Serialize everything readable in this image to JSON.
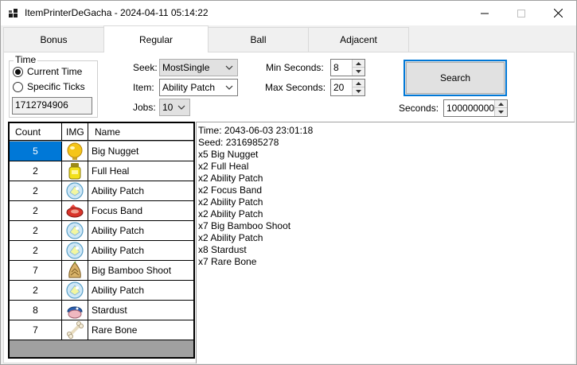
{
  "window": {
    "title": "ItemPrinterDeGacha - 2024-04-11 05:14:22",
    "icon": "app-grid-icon",
    "controls": [
      "minimize-icon",
      "maximize-icon",
      "close-icon"
    ]
  },
  "tabs": [
    {
      "label": "Bonus"
    },
    {
      "label": "Regular"
    },
    {
      "label": "Ball"
    },
    {
      "label": "Adjacent"
    }
  ],
  "active_tab": "Regular",
  "time_group": {
    "legend": "Time",
    "option_current": "Current Time",
    "option_specific": "Specific Ticks",
    "selected": "Current Time",
    "ticks_value": "1712794906"
  },
  "params": {
    "seek_label": "Seek:",
    "seek_value": "MostSingle",
    "item_label": "Item:",
    "item_value": "Ability Patch",
    "jobs_label": "Jobs:",
    "jobs_value": "10",
    "min_seconds_label": "Min Seconds:",
    "min_seconds_value": "8",
    "max_seconds_label": "Max Seconds:",
    "max_seconds_value": "20",
    "seconds_label": "Seconds:",
    "seconds_value": "1000000000"
  },
  "search_button": "Search",
  "grid": {
    "headers": {
      "count": "Count",
      "img": "IMG",
      "name": "Name"
    },
    "rows": [
      {
        "count": "5",
        "icon": "big-nugget-icon",
        "name": "Big Nugget"
      },
      {
        "count": "2",
        "icon": "full-heal-icon",
        "name": "Full Heal"
      },
      {
        "count": "2",
        "icon": "ability-patch-icon",
        "name": "Ability Patch"
      },
      {
        "count": "2",
        "icon": "focus-band-icon",
        "name": "Focus Band"
      },
      {
        "count": "2",
        "icon": "ability-patch-icon",
        "name": "Ability Patch"
      },
      {
        "count": "2",
        "icon": "ability-patch-icon",
        "name": "Ability Patch"
      },
      {
        "count": "7",
        "icon": "big-bamboo-shoot-icon",
        "name": "Big Bamboo Shoot"
      },
      {
        "count": "2",
        "icon": "ability-patch-icon",
        "name": "Ability Patch"
      },
      {
        "count": "8",
        "icon": "stardust-icon",
        "name": "Stardust"
      },
      {
        "count": "7",
        "icon": "rare-bone-icon",
        "name": "Rare Bone"
      }
    ],
    "selected_row": 0
  },
  "results": {
    "time": "Time: 2043-06-03 23:01:18",
    "seed": "Seed: 2316985278",
    "lines": [
      "x5 Big Nugget",
      "x2 Full Heal",
      "x2 Ability Patch",
      "x2 Focus Band",
      "x2 Ability Patch",
      "x2 Ability Patch",
      "x7 Big Bamboo Shoot",
      "x2 Ability Patch",
      "x8 Stardust",
      "x7 Rare Bone"
    ]
  },
  "colors": {
    "accent": "#0078d7",
    "background": "#f0f0f0",
    "grid_empty": "#a0a0a0"
  }
}
